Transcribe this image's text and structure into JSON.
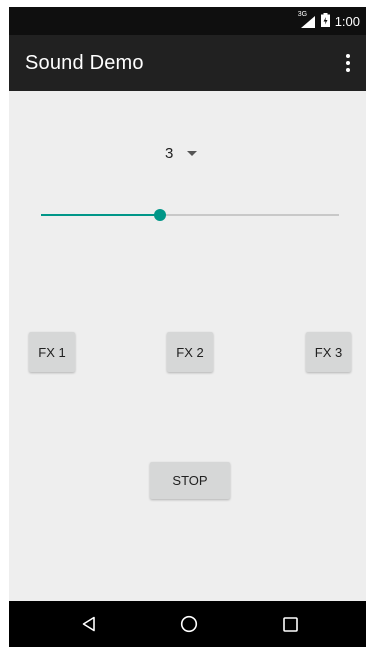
{
  "status_bar": {
    "network_label": "3G",
    "time": "1:00",
    "icons": [
      "signal-icon",
      "battery-icon"
    ]
  },
  "app_bar": {
    "title": "Sound Demo",
    "menu_icon": "overflow-menu-icon"
  },
  "spinner": {
    "selected_value": "3",
    "icon": "dropdown-arrow-icon"
  },
  "slider": {
    "level": 0.4,
    "accent_color": "#009688"
  },
  "buttons": {
    "fx1": "FX 1",
    "fx2": "FX 2",
    "fx3": "FX 3",
    "stop": "STOP"
  },
  "nav_bar": {
    "icons": [
      "back-icon",
      "home-icon",
      "recents-icon"
    ]
  }
}
